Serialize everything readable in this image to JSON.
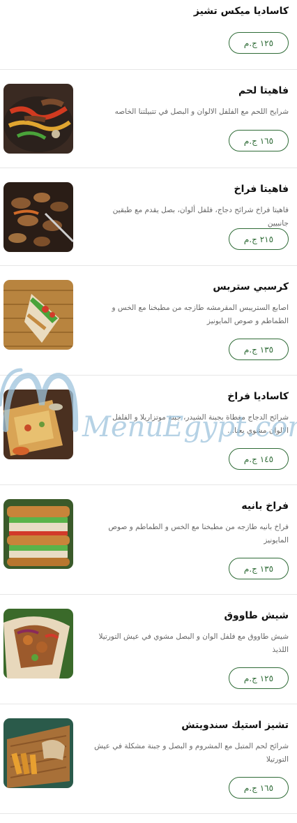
{
  "menu": {
    "items": [
      {
        "name": "كاساديا ميكس تشيز",
        "desc": "",
        "price": "١٢٥ ج.م"
      },
      {
        "name": "فاهيتا لحم",
        "desc": "شرايح اللحم مع الفلفل الالوان و البصل في تتبيلتنا الخاصه",
        "price": "١٦٥ ج.م",
        "image": "beef-fajita-photo"
      },
      {
        "name": "فاهيتا فراخ",
        "desc": "فاهيتا فراخ شرائح دجاج، فلفل ألوان، بصل يقدم مع طبقين جانبيين",
        "price": "٢١٥ ج.م",
        "image": "chicken-fajita-photo"
      },
      {
        "name": "كرسبي ستربس",
        "desc": "اصابع الستريبس المقرمشه طازجه من مطبخنا مع الخس و الطماطم و صوص المايونيز",
        "price": "١٣٥ ج.م",
        "image": "crispy-strips-wrap-photo"
      },
      {
        "name": "كاساديا فراخ",
        "desc": "شرائح الدجاج مغطاة بجبنة الشيدر، جبنة موتزاريلا و الفلفل الالوان مشوي بعنا...",
        "price": "١٤٥ ج.م",
        "image": "chicken-quesadilla-photo"
      },
      {
        "name": "فراخ بانيه",
        "desc": "فراخ بانيه طازجه من مطبخنا مع الخس و الطماطم و صوص المايونيز",
        "price": "١٣٥ ج.م",
        "image": "chicken-pane-sandwich-photo"
      },
      {
        "name": "شيش طاووق",
        "desc": "شيش طاووق مع فلفل الوان و البصل مشوي في عيش التورتيلا اللذيذ",
        "price": "١٢٥ ج.م",
        "image": "shish-tawook-wrap-photo"
      },
      {
        "name": "تشيز استيك سندويتش",
        "desc": "شرائح لحم المتبل مع المشروم و البصل و جبنة مشكلة في عيش التورتيلا",
        "price": "١٦٥ ج.م",
        "image": "cheese-steak-sandwich-photo"
      }
    ]
  },
  "watermark": {
    "text": "MenuEgypt.com"
  },
  "colors": {
    "accent": "#2e6b36",
    "watermark": "#9ec4dd"
  }
}
